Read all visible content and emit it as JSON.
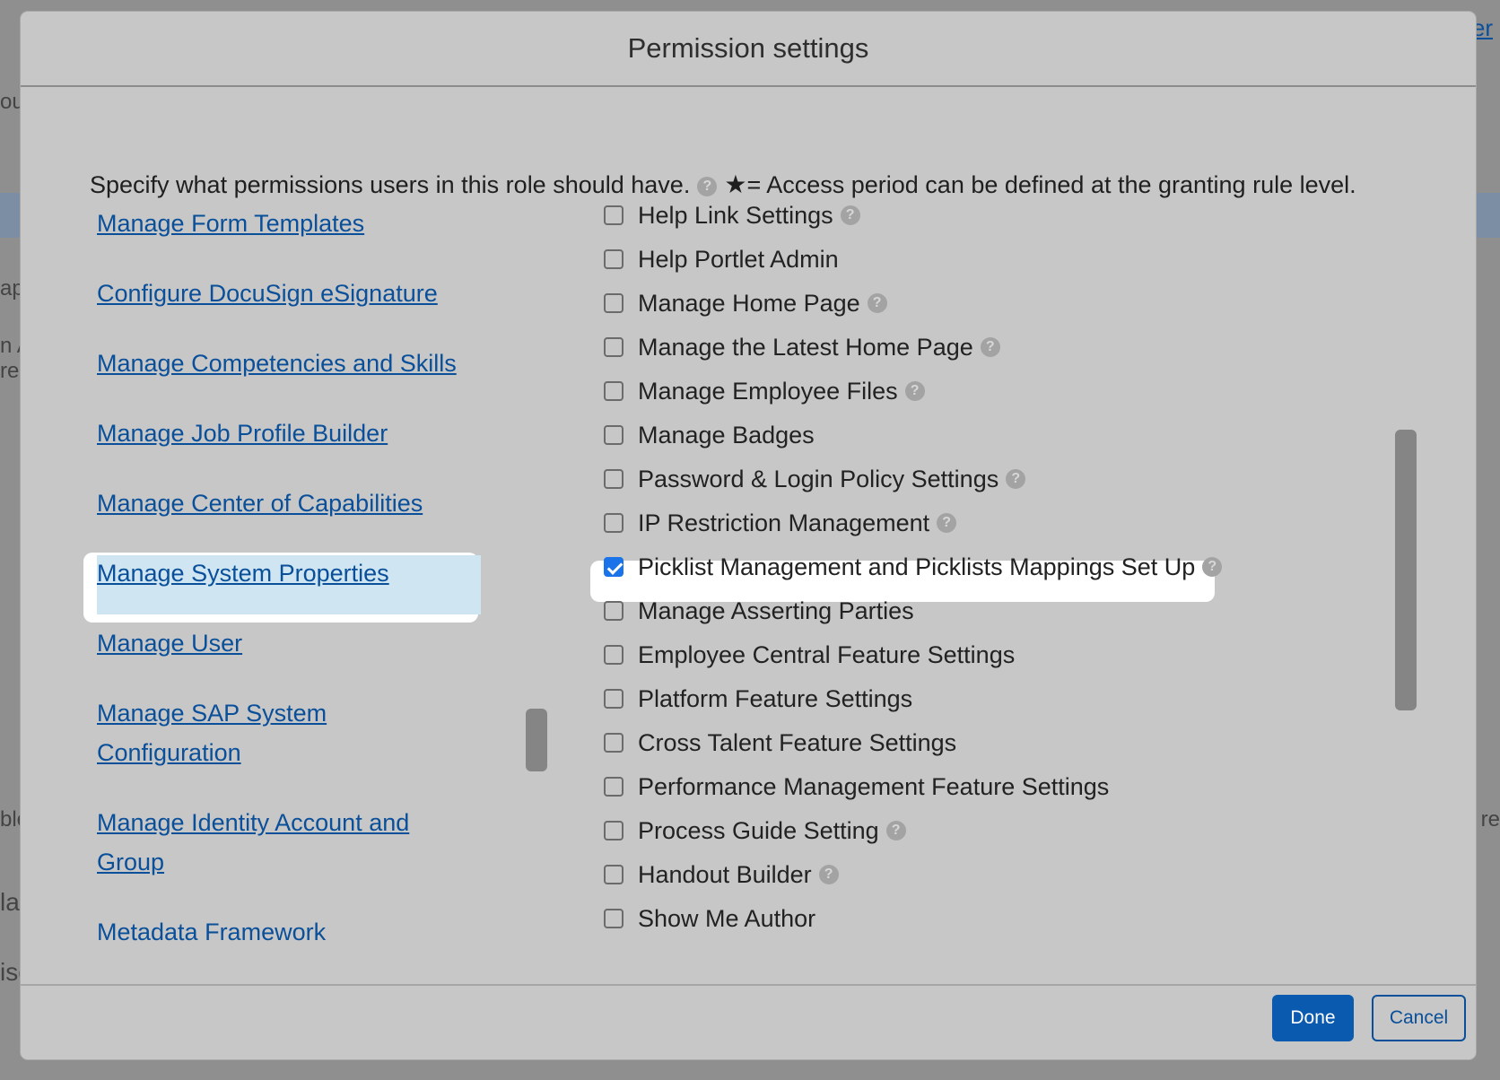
{
  "background": {
    "frag_top_right": "er",
    "frag_left_1": "ou",
    "frag_left_2": "ap",
    "frag_left_3": "n A",
    "frag_left_4": "rea",
    "frag_left_5": "ble",
    "frag_left_6": "lal",
    "frag_left_7": "ise",
    "frag_right_1": "it re"
  },
  "dialog": {
    "title": "Permission settings",
    "intro_text": "Specify what permissions users in this role should have.",
    "intro_star": "★",
    "intro_star_text": "= Access period can be defined at the granting rule level.",
    "help_glyph": "?"
  },
  "left_nav": {
    "items": [
      {
        "label": "Manage Form Templates"
      },
      {
        "label": "Configure DocuSign eSignature"
      },
      {
        "label": "Manage Competencies and Skills"
      },
      {
        "label": "Manage Job Profile Builder"
      },
      {
        "label": "Manage Center of Capabilities"
      },
      {
        "label": "Manage System Properties",
        "selected": true
      },
      {
        "label": "Manage User"
      },
      {
        "label": "Manage SAP System Configuration"
      },
      {
        "label": "Manage Identity Account and Group"
      },
      {
        "label": "Metadata Framework"
      }
    ]
  },
  "permissions": {
    "items": [
      {
        "label": "Help Link Settings",
        "checked": false,
        "help": true
      },
      {
        "label": "Help Portlet Admin",
        "checked": false,
        "help": false
      },
      {
        "label": "Manage Home Page",
        "checked": false,
        "help": true
      },
      {
        "label": "Manage the Latest Home Page",
        "checked": false,
        "help": true
      },
      {
        "label": "Manage Employee Files",
        "checked": false,
        "help": true
      },
      {
        "label": "Manage Badges",
        "checked": false,
        "help": false
      },
      {
        "label": "Password & Login Policy Settings",
        "checked": false,
        "help": true
      },
      {
        "label": "IP Restriction Management",
        "checked": false,
        "help": true
      },
      {
        "label": "Picklist Management and Picklists Mappings Set Up",
        "checked": true,
        "help": true
      },
      {
        "label": "Manage Asserting Parties",
        "checked": false,
        "help": false
      },
      {
        "label": "Employee Central Feature Settings",
        "checked": false,
        "help": false
      },
      {
        "label": "Platform Feature Settings",
        "checked": false,
        "help": false
      },
      {
        "label": "Cross Talent Feature Settings",
        "checked": false,
        "help": false
      },
      {
        "label": "Performance Management Feature Settings",
        "checked": false,
        "help": false
      },
      {
        "label": "Process Guide Setting",
        "checked": false,
        "help": true
      },
      {
        "label": "Handout Builder",
        "checked": false,
        "help": true
      },
      {
        "label": "Show Me Author",
        "checked": false,
        "help": false
      }
    ]
  },
  "footer": {
    "done_label": "Done",
    "cancel_label": "Cancel"
  },
  "colors": {
    "link": "#0a4f99",
    "primary_button": "#0a5bb0",
    "checkbox_checked": "#1a73e8",
    "selected_highlight": "#cfe5f2"
  }
}
